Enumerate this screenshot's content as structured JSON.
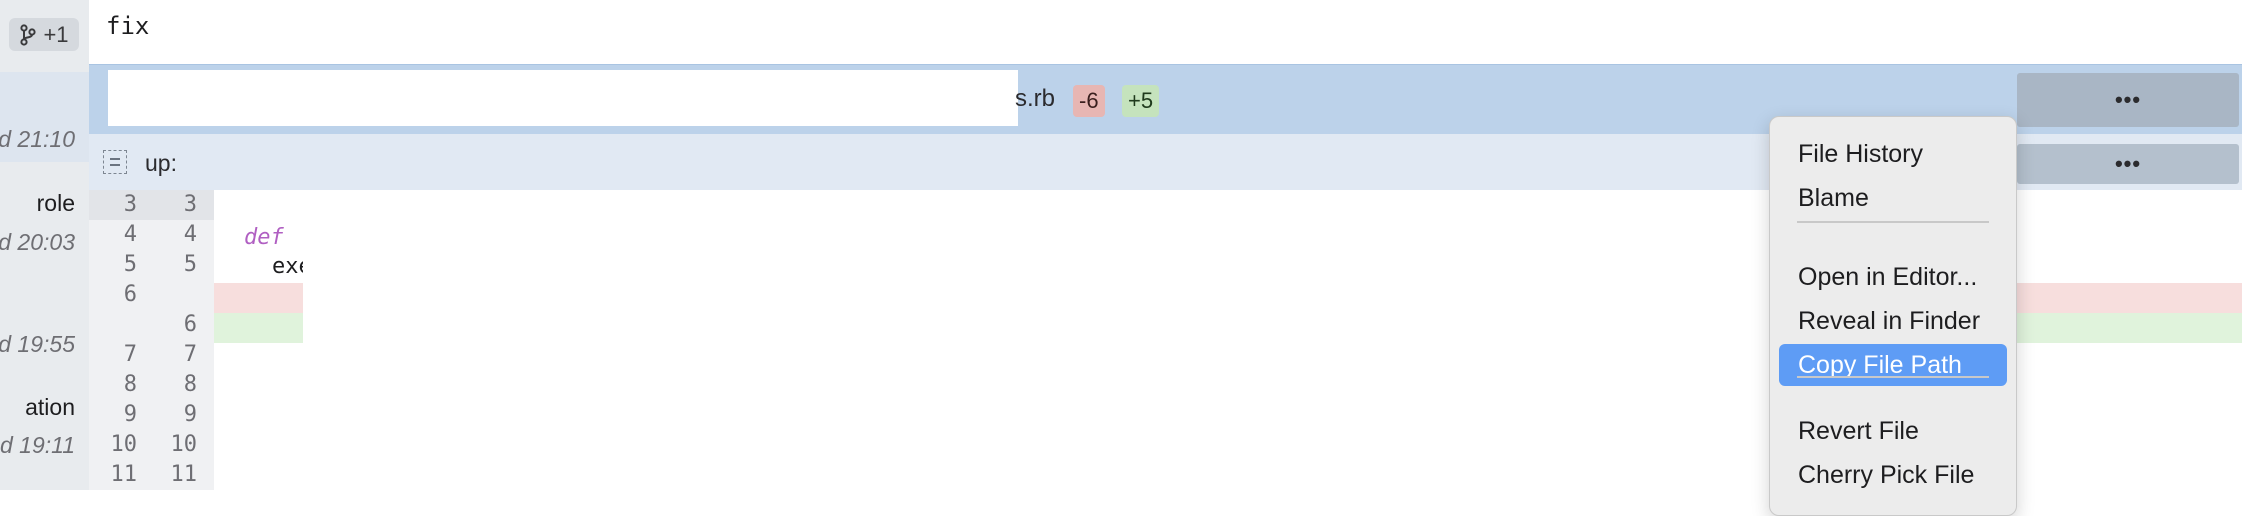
{
  "sidebar": {
    "branch_badge": "+1",
    "lines": [
      {
        "text": "d 21:10",
        "style": "italic"
      },
      {
        "text": "role",
        "style": "title"
      },
      {
        "text": "d 20:03",
        "style": "italic"
      },
      {
        "text": "d 19:55",
        "style": "italic"
      },
      {
        "text": "ation",
        "style": "title"
      },
      {
        "text": "d 19:11",
        "style": "italic"
      }
    ]
  },
  "commit": {
    "message": "fix"
  },
  "file": {
    "name_fragment": "s.rb",
    "deletions": "-6",
    "additions": "+5",
    "more_label": "•••"
  },
  "hunk": {
    "label": "up:",
    "more_label": "•••"
  },
  "code": {
    "lines": [
      {
        "old": "3",
        "new": "3"
      },
      {
        "old": "4",
        "new": "4"
      },
      {
        "old": "5",
        "new": "5"
      },
      {
        "old": "6",
        "new": ""
      },
      {
        "old": "",
        "new": "6"
      },
      {
        "old": "7",
        "new": "7"
      },
      {
        "old": "8",
        "new": "8"
      },
      {
        "old": "9",
        "new": "9"
      },
      {
        "old": "10",
        "new": "10"
      },
      {
        "old": "11",
        "new": "11"
      }
    ],
    "keyword": "def",
    "fragment": "exe"
  },
  "context_menu": {
    "items": [
      {
        "label": "File History"
      },
      {
        "label": "Blame"
      },
      {
        "label": "Open in Editor..."
      },
      {
        "label": "Reveal in Finder"
      },
      {
        "label": "Copy File Path"
      },
      {
        "label": "Revert File"
      },
      {
        "label": "Cherry Pick File"
      }
    ],
    "selected": "Copy File Path"
  },
  "colors": {
    "selected_item": "#5e9cf5",
    "deleted_row": "#f7dedd",
    "added_row": "#e0f3dc",
    "file_header": "#bcd2ea"
  }
}
